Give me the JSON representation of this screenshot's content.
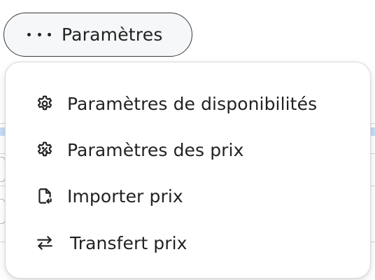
{
  "trigger": {
    "label": "Paramètres",
    "icon": "more-horizontal-icon"
  },
  "menu": {
    "items": [
      {
        "label": "Paramètres de disponibilités",
        "icon": "gear-icon"
      },
      {
        "label": "Paramètres des prix",
        "icon": "price-settings-icon"
      },
      {
        "label": "Importer prix",
        "icon": "file-import-icon"
      },
      {
        "label": "Transfert prix",
        "icon": "transfer-arrows-icon"
      }
    ]
  },
  "colors": {
    "text": "#222222",
    "trigger_bg": "#f6f7f9",
    "menu_border": "#d9d9d9",
    "background_accent": "#c9dcf5"
  }
}
